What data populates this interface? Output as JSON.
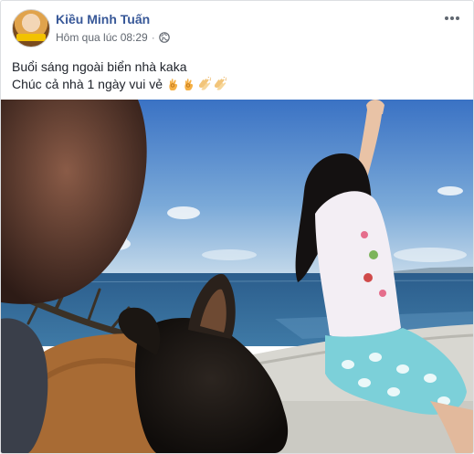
{
  "post": {
    "author": "Kiều Minh Tuấn",
    "timestamp": "Hôm qua lúc 08:29",
    "separator": "·",
    "privacy_icon": "globe-icon",
    "menu_icon": "more-horizontal-icon",
    "text_line1": "Buổi sáng ngoài biển nhà kaka",
    "text_line2": "Chúc cả nhà 1 ngày vui vẻ",
    "emojis": [
      "ok-hand-icon",
      "ok-hand-icon",
      "clapping-hands-icon",
      "clapping-hands-icon"
    ]
  },
  "photo": {
    "description_name": "post-photo",
    "colors": {
      "sky_top": "#3d78c9",
      "sky_bottom": "#bcd5e8",
      "sea": "#2d5f8e",
      "wall": "#d9d9d4",
      "dog": "#a9703a",
      "shorts": "#7fd0d8"
    }
  }
}
